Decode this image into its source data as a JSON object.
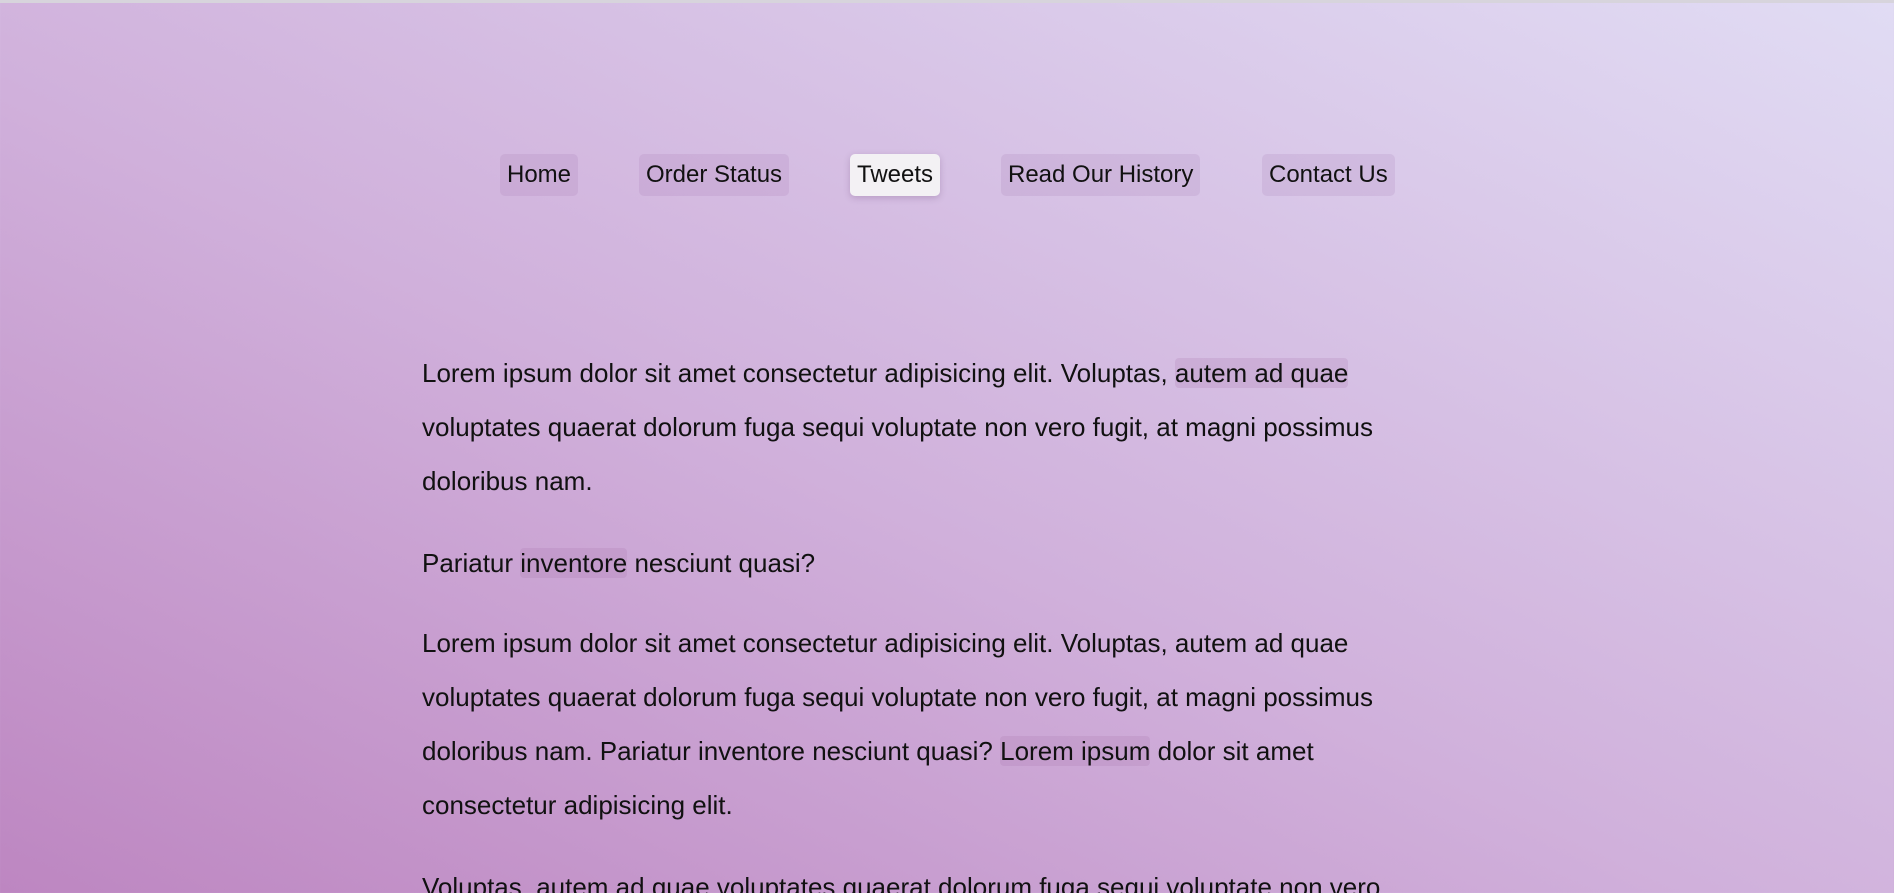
{
  "nav": {
    "items": [
      {
        "label": "Home",
        "active": false
      },
      {
        "label": "Order Status",
        "active": false
      },
      {
        "label": "Tweets",
        "active": true
      },
      {
        "label": "Read Our History",
        "active": false
      },
      {
        "label": "Contact Us",
        "active": false
      }
    ]
  },
  "content": {
    "p1": {
      "part1": "Lorem ipsum dolor sit amet consectetur adipisicing elit. Voluptas, ",
      "highlight": "autem ad quae",
      "part2": " voluptates quaerat dolorum fuga sequi voluptate non vero fugit, at magni possimus doloribus nam."
    },
    "p2": {
      "part1": "Pariatur ",
      "highlight": "inventore",
      "part2": " nesciunt quasi?"
    },
    "p3": {
      "part1": "Lorem ipsum dolor sit amet consectetur adipisicing elit. Voluptas, autem ad quae voluptates quaerat dolorum fuga sequi voluptate non vero fugit, at magni possimus doloribus nam. Pariatur inventore nesciunt quasi? ",
      "highlight": "Lorem ipsum",
      "part2": " dolor sit amet consectetur adipisicing elit."
    },
    "p4": {
      "text": "Voluptas, autem ad quae voluptates quaerat dolorum fuga sequi voluptate non vero"
    }
  },
  "colors": {
    "gradient_start": "#bd86c1",
    "gradient_end": "#e1dcf4",
    "active_tab_bg": "#f3f1f4"
  }
}
